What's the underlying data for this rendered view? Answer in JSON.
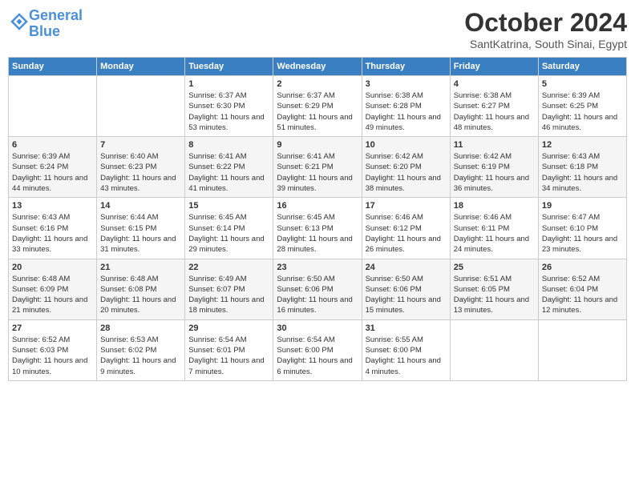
{
  "header": {
    "logo_line1": "General",
    "logo_line2": "Blue",
    "title": "October 2024",
    "subtitle": "SantKatrina, South Sinai, Egypt"
  },
  "weekdays": [
    "Sunday",
    "Monday",
    "Tuesday",
    "Wednesday",
    "Thursday",
    "Friday",
    "Saturday"
  ],
  "weeks": [
    [
      {
        "day": "",
        "info": ""
      },
      {
        "day": "",
        "info": ""
      },
      {
        "day": "1",
        "info": "Sunrise: 6:37 AM\nSunset: 6:30 PM\nDaylight: 11 hours and 53 minutes."
      },
      {
        "day": "2",
        "info": "Sunrise: 6:37 AM\nSunset: 6:29 PM\nDaylight: 11 hours and 51 minutes."
      },
      {
        "day": "3",
        "info": "Sunrise: 6:38 AM\nSunset: 6:28 PM\nDaylight: 11 hours and 49 minutes."
      },
      {
        "day": "4",
        "info": "Sunrise: 6:38 AM\nSunset: 6:27 PM\nDaylight: 11 hours and 48 minutes."
      },
      {
        "day": "5",
        "info": "Sunrise: 6:39 AM\nSunset: 6:25 PM\nDaylight: 11 hours and 46 minutes."
      }
    ],
    [
      {
        "day": "6",
        "info": "Sunrise: 6:39 AM\nSunset: 6:24 PM\nDaylight: 11 hours and 44 minutes."
      },
      {
        "day": "7",
        "info": "Sunrise: 6:40 AM\nSunset: 6:23 PM\nDaylight: 11 hours and 43 minutes."
      },
      {
        "day": "8",
        "info": "Sunrise: 6:41 AM\nSunset: 6:22 PM\nDaylight: 11 hours and 41 minutes."
      },
      {
        "day": "9",
        "info": "Sunrise: 6:41 AM\nSunset: 6:21 PM\nDaylight: 11 hours and 39 minutes."
      },
      {
        "day": "10",
        "info": "Sunrise: 6:42 AM\nSunset: 6:20 PM\nDaylight: 11 hours and 38 minutes."
      },
      {
        "day": "11",
        "info": "Sunrise: 6:42 AM\nSunset: 6:19 PM\nDaylight: 11 hours and 36 minutes."
      },
      {
        "day": "12",
        "info": "Sunrise: 6:43 AM\nSunset: 6:18 PM\nDaylight: 11 hours and 34 minutes."
      }
    ],
    [
      {
        "day": "13",
        "info": "Sunrise: 6:43 AM\nSunset: 6:16 PM\nDaylight: 11 hours and 33 minutes."
      },
      {
        "day": "14",
        "info": "Sunrise: 6:44 AM\nSunset: 6:15 PM\nDaylight: 11 hours and 31 minutes."
      },
      {
        "day": "15",
        "info": "Sunrise: 6:45 AM\nSunset: 6:14 PM\nDaylight: 11 hours and 29 minutes."
      },
      {
        "day": "16",
        "info": "Sunrise: 6:45 AM\nSunset: 6:13 PM\nDaylight: 11 hours and 28 minutes."
      },
      {
        "day": "17",
        "info": "Sunrise: 6:46 AM\nSunset: 6:12 PM\nDaylight: 11 hours and 26 minutes."
      },
      {
        "day": "18",
        "info": "Sunrise: 6:46 AM\nSunset: 6:11 PM\nDaylight: 11 hours and 24 minutes."
      },
      {
        "day": "19",
        "info": "Sunrise: 6:47 AM\nSunset: 6:10 PM\nDaylight: 11 hours and 23 minutes."
      }
    ],
    [
      {
        "day": "20",
        "info": "Sunrise: 6:48 AM\nSunset: 6:09 PM\nDaylight: 11 hours and 21 minutes."
      },
      {
        "day": "21",
        "info": "Sunrise: 6:48 AM\nSunset: 6:08 PM\nDaylight: 11 hours and 20 minutes."
      },
      {
        "day": "22",
        "info": "Sunrise: 6:49 AM\nSunset: 6:07 PM\nDaylight: 11 hours and 18 minutes."
      },
      {
        "day": "23",
        "info": "Sunrise: 6:50 AM\nSunset: 6:06 PM\nDaylight: 11 hours and 16 minutes."
      },
      {
        "day": "24",
        "info": "Sunrise: 6:50 AM\nSunset: 6:06 PM\nDaylight: 11 hours and 15 minutes."
      },
      {
        "day": "25",
        "info": "Sunrise: 6:51 AM\nSunset: 6:05 PM\nDaylight: 11 hours and 13 minutes."
      },
      {
        "day": "26",
        "info": "Sunrise: 6:52 AM\nSunset: 6:04 PM\nDaylight: 11 hours and 12 minutes."
      }
    ],
    [
      {
        "day": "27",
        "info": "Sunrise: 6:52 AM\nSunset: 6:03 PM\nDaylight: 11 hours and 10 minutes."
      },
      {
        "day": "28",
        "info": "Sunrise: 6:53 AM\nSunset: 6:02 PM\nDaylight: 11 hours and 9 minutes."
      },
      {
        "day": "29",
        "info": "Sunrise: 6:54 AM\nSunset: 6:01 PM\nDaylight: 11 hours and 7 minutes."
      },
      {
        "day": "30",
        "info": "Sunrise: 6:54 AM\nSunset: 6:00 PM\nDaylight: 11 hours and 6 minutes."
      },
      {
        "day": "31",
        "info": "Sunrise: 6:55 AM\nSunset: 6:00 PM\nDaylight: 11 hours and 4 minutes."
      },
      {
        "day": "",
        "info": ""
      },
      {
        "day": "",
        "info": ""
      }
    ]
  ]
}
